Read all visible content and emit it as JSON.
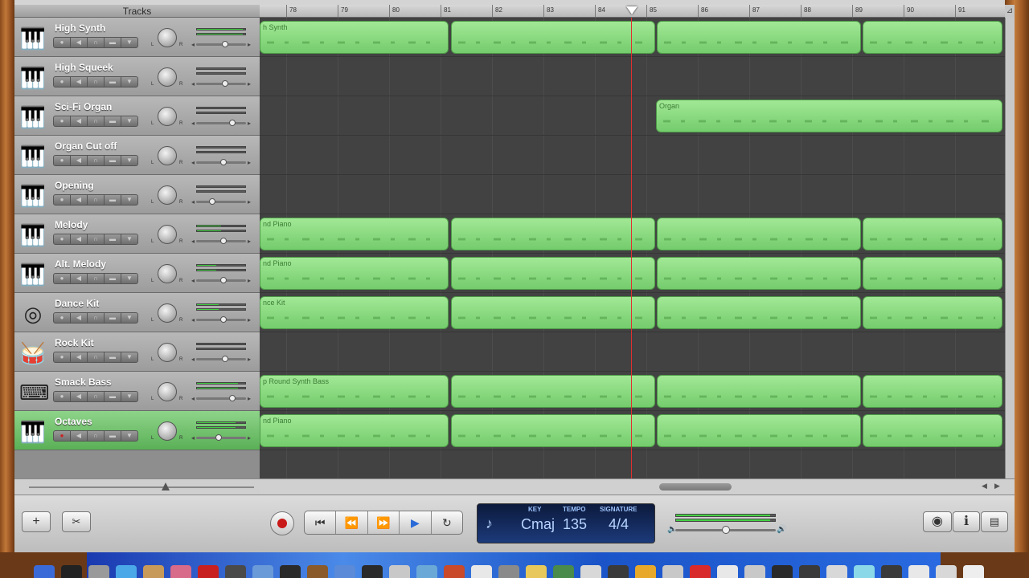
{
  "header": {
    "tracks_label": "Tracks"
  },
  "ruler": {
    "bars": [
      "78",
      "79",
      "80",
      "81",
      "82",
      "83",
      "84",
      "85",
      "86",
      "87",
      "88",
      "89",
      "90",
      "91"
    ]
  },
  "tracks": [
    {
      "name": "High Synth",
      "icon": "grand-piano-icon",
      "level": 0.95,
      "vol": 0.6,
      "region": "h Synth",
      "regions": [
        [
          0,
          235
        ],
        [
          238,
          492
        ],
        [
          494,
          748
        ],
        [
          750,
          924
        ]
      ]
    },
    {
      "name": "High Squeek",
      "icon": "grand-piano-icon",
      "level": 0.0,
      "vol": 0.6,
      "region": "",
      "regions": []
    },
    {
      "name": "Sci-Fi Organ",
      "icon": "grand-piano-icon",
      "level": 0.0,
      "vol": 0.75,
      "region": "Organ",
      "regions": [
        [
          493,
          924
        ]
      ]
    },
    {
      "name": "Organ Cut off",
      "icon": "grand-piano-icon",
      "level": 0.0,
      "vol": 0.55,
      "region": "",
      "regions": []
    },
    {
      "name": "Opening",
      "icon": "grand-piano-icon",
      "level": 0.0,
      "vol": 0.3,
      "region": "",
      "regions": []
    },
    {
      "name": "Melody",
      "icon": "grand-piano-icon",
      "level": 0.5,
      "vol": 0.55,
      "region": "nd Piano",
      "regions": [
        [
          0,
          235
        ],
        [
          238,
          492
        ],
        [
          494,
          748
        ],
        [
          750,
          924
        ]
      ]
    },
    {
      "name": "Alt. Melody",
      "icon": "grand-piano-icon",
      "level": 0.4,
      "vol": 0.55,
      "region": "nd Piano",
      "regions": [
        [
          0,
          235
        ],
        [
          238,
          492
        ],
        [
          494,
          748
        ],
        [
          750,
          924
        ]
      ]
    },
    {
      "name": "Dance Kit",
      "icon": "drum-machine-icon",
      "level": 0.45,
      "vol": 0.55,
      "region": "nce Kit",
      "regions": [
        [
          0,
          235
        ],
        [
          238,
          492
        ],
        [
          494,
          748
        ],
        [
          750,
          924
        ]
      ]
    },
    {
      "name": "Rock Kit",
      "icon": "drum-kit-icon",
      "level": 0.0,
      "vol": 0.6,
      "region": "",
      "regions": []
    },
    {
      "name": "Smack Bass",
      "icon": "keyboard-icon",
      "level": 0.85,
      "vol": 0.75,
      "region": "p Round Synth Bass",
      "regions": [
        [
          0,
          235
        ],
        [
          238,
          492
        ],
        [
          494,
          748
        ],
        [
          750,
          924
        ]
      ]
    },
    {
      "name": "Octaves",
      "icon": "grand-piano-icon",
      "level": 0.8,
      "vol": 0.45,
      "region": "nd Piano",
      "regions": [
        [
          0,
          235
        ],
        [
          238,
          492
        ],
        [
          494,
          748
        ],
        [
          750,
          924
        ]
      ],
      "selected": true
    }
  ],
  "lcd": {
    "key_label": "KEY",
    "key": "Cmaj",
    "tempo_label": "TEMPO",
    "tempo": "135",
    "sig_label": "SIGNATURE",
    "sig": "4/4"
  },
  "master": {
    "level": 0.95,
    "vol": 0.5
  }
}
